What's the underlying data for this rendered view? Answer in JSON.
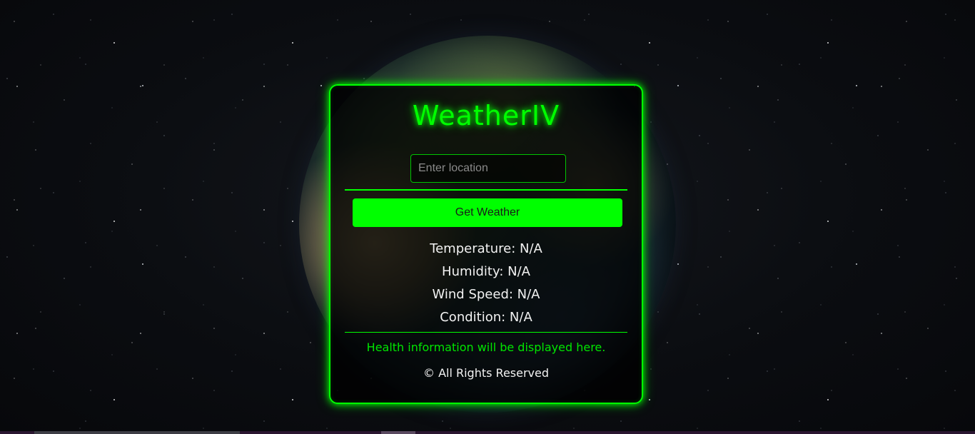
{
  "app": {
    "title": "WeatherIV"
  },
  "search": {
    "placeholder": "Enter location",
    "value": ""
  },
  "actions": {
    "get_weather_label": "Get Weather"
  },
  "weather": {
    "temperature": "Temperature: N/A",
    "humidity": "Humidity: N/A",
    "wind_speed": "Wind Speed: N/A",
    "condition": "Condition: N/A"
  },
  "health": {
    "message": "Health information will be displayed here."
  },
  "footer": {
    "copyright": "© All Rights Reserved"
  },
  "colors": {
    "accent": "#00ff00",
    "background": "#0b0d11",
    "text": "#f2f2f2"
  }
}
